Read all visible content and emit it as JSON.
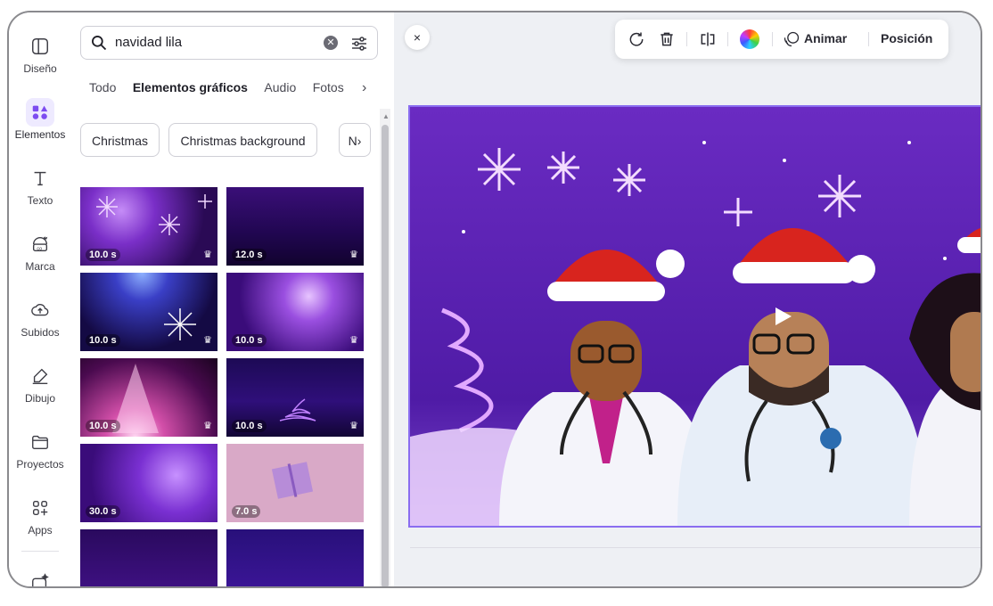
{
  "rail": {
    "items": [
      {
        "label": "Diseño",
        "icon": "layout-icon"
      },
      {
        "label": "Elementos",
        "icon": "elements-icon"
      },
      {
        "label": "Texto",
        "icon": "text-icon"
      },
      {
        "label": "Marca",
        "icon": "brand-icon"
      },
      {
        "label": "Subidos",
        "icon": "cloud-upload-icon"
      },
      {
        "label": "Dibujo",
        "icon": "draw-icon"
      },
      {
        "label": "Proyectos",
        "icon": "folder-icon"
      },
      {
        "label": "Apps",
        "icon": "apps-icon"
      }
    ]
  },
  "search": {
    "value": "navidad lila",
    "clear": "✕"
  },
  "tabs": [
    {
      "label": "Todo"
    },
    {
      "label": "Elementos gráficos"
    },
    {
      "label": "Audio"
    },
    {
      "label": "Fotos"
    }
  ],
  "tabs_more": "›",
  "chips": [
    {
      "label": "Christmas"
    },
    {
      "label": "Christmas background"
    }
  ],
  "chips_more": "N›",
  "thumbs": [
    {
      "duration": "10.0 s",
      "premium": true
    },
    {
      "duration": "12.0 s",
      "premium": true
    },
    {
      "duration": "10.0 s",
      "premium": true
    },
    {
      "duration": "10.0 s",
      "premium": true
    },
    {
      "duration": "10.0 s",
      "premium": true
    },
    {
      "duration": "10.0 s",
      "premium": true
    },
    {
      "duration": "30.0 s",
      "premium": false
    },
    {
      "duration": "7.0 s",
      "premium": false
    },
    {
      "duration": "",
      "premium": false
    },
    {
      "duration": "",
      "premium": false
    }
  ],
  "canvas": {
    "close": "×"
  },
  "toolbar": {
    "animate_label": "Animar",
    "position_label": "Posición"
  },
  "colors": {
    "accent": "#7d4cf0",
    "slide_bg": "#5a22b0"
  }
}
